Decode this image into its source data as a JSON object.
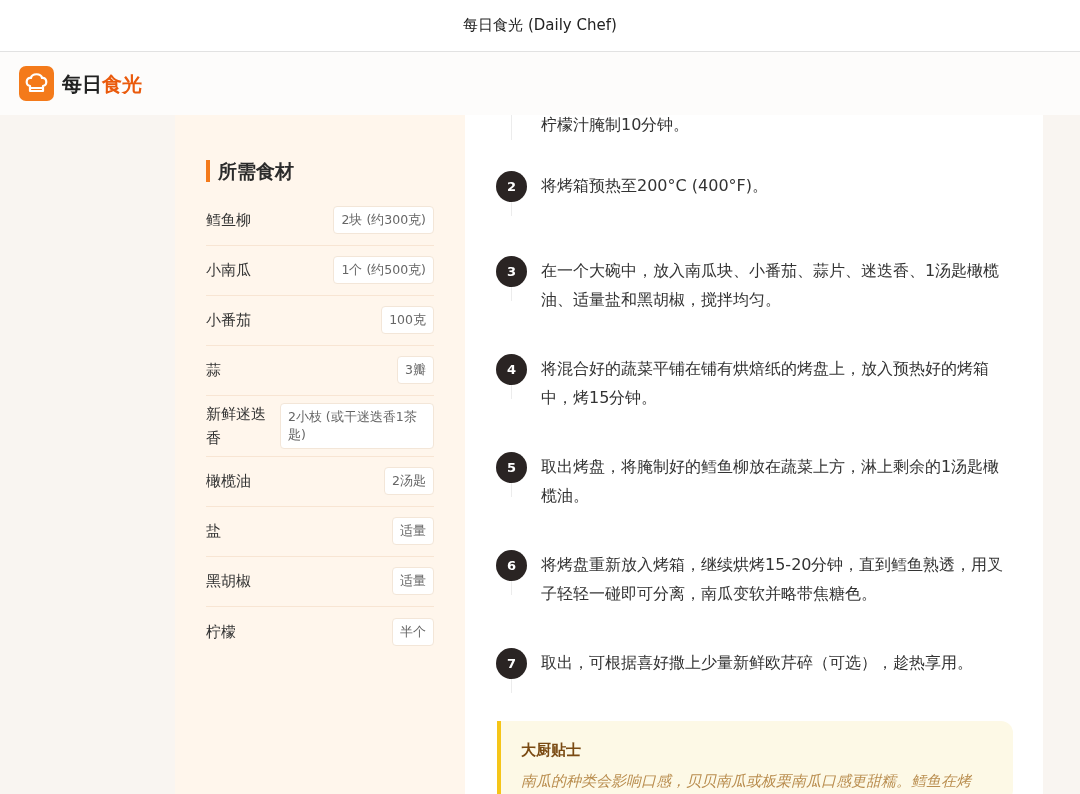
{
  "window": {
    "title": "每日食光 (Daily Chef)"
  },
  "header": {
    "brand": [
      {
        "text": "每日",
        "kind": "plain"
      },
      {
        "text": "食光",
        "kind": "accent"
      }
    ]
  },
  "ingredients": {
    "title": "所需食材",
    "items": [
      {
        "name": "鳕鱼柳",
        "amount": "2块 (约300克)"
      },
      {
        "name": "小南瓜",
        "amount": "1个 (约500克)"
      },
      {
        "name": "小番茄",
        "amount": "100克"
      },
      {
        "name": "蒜",
        "amount": "3瓣"
      },
      {
        "name": "新鲜迷迭香",
        "amount": "2小枝 (或干迷迭香1茶匙)"
      },
      {
        "name": "橄榄油",
        "amount": "2汤匙"
      },
      {
        "name": "盐",
        "amount": "适量"
      },
      {
        "name": "黑胡椒",
        "amount": "适量"
      },
      {
        "name": "柠檬",
        "amount": "半个"
      }
    ]
  },
  "steps": [
    {
      "text": "柠檬汁腌制10分钟。"
    },
    {
      "number": "2",
      "text": "将烤箱预热至200°C (400°F)。"
    },
    {
      "number": "3",
      "text": "在一个大碗中，放入南瓜块、小番茄、蒜片、迷迭香、1汤匙橄榄油、适量盐和黑胡椒，搅拌均匀。"
    },
    {
      "number": "4",
      "text": "将混合好的蔬菜平铺在铺有烘焙纸的烤盘上，放入预热好的烤箱中，烤15分钟。"
    },
    {
      "number": "5",
      "text": "取出烤盘，将腌制好的鳕鱼柳放在蔬菜上方，淋上剩余的1汤匙橄榄油。"
    },
    {
      "number": "6",
      "text": "将烤盘重新放入烤箱，继续烘烤15-20分钟，直到鳕鱼熟透，用叉子轻轻一碰即可分离，南瓜变软并略带焦糖色。"
    },
    {
      "number": "7",
      "text": "取出，可根据喜好撒上少量新鲜欧芹碎（可选），趁热享用。"
    }
  ],
  "tip": {
    "title": "大厨贴士",
    "text": "南瓜的种类会影响口感，贝贝南瓜或板栗南瓜口感更甜糯。鳕鱼在烤"
  }
}
